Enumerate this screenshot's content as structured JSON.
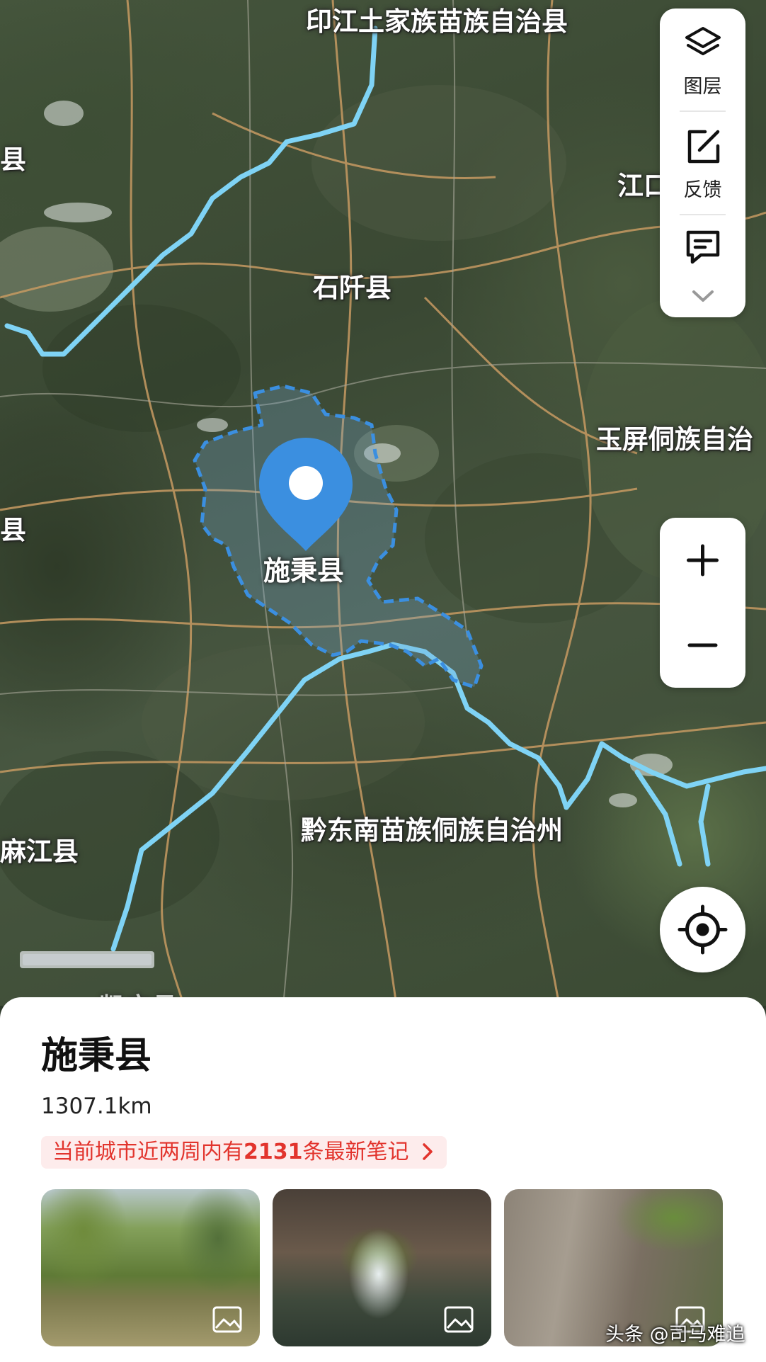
{
  "map": {
    "labels": {
      "top_county": "印江土家族苗族自治县",
      "left_edge_1": "县",
      "right_edge_1": "江口",
      "shiqian": "石阡县",
      "yuping": "玉屏侗族自治",
      "left_edge_2": "县",
      "qiandongnan": "黔东南苗族侗族自治州",
      "majiang": "麻江县",
      "bottom_cut": "凯宁县"
    },
    "selected_place_label": "施秉县",
    "pin_color": "#3b8fe0",
    "boundary_color": "#3b8fe0",
    "river_color": "#7fd3f5"
  },
  "toolbar": {
    "layers_label": "图层",
    "feedback_label": "反馈",
    "message_icon": "message-icon",
    "more_icon": "chevron-down-icon"
  },
  "zoom": {
    "in_symbol": "+",
    "out_symbol": "−"
  },
  "locate_icon": "locate-icon",
  "sheet": {
    "title": "施秉县",
    "distance": "1307.1km",
    "notes_prefix": "当前城市近两周内有",
    "notes_count": "2131",
    "notes_suffix": "条最新笔记",
    "accent_color": "#e2342d"
  },
  "photos": [
    {
      "icon": "image-icon"
    },
    {
      "icon": "image-icon"
    },
    {
      "icon": "image-icon"
    }
  ],
  "watermark": "头条 @司马难追"
}
